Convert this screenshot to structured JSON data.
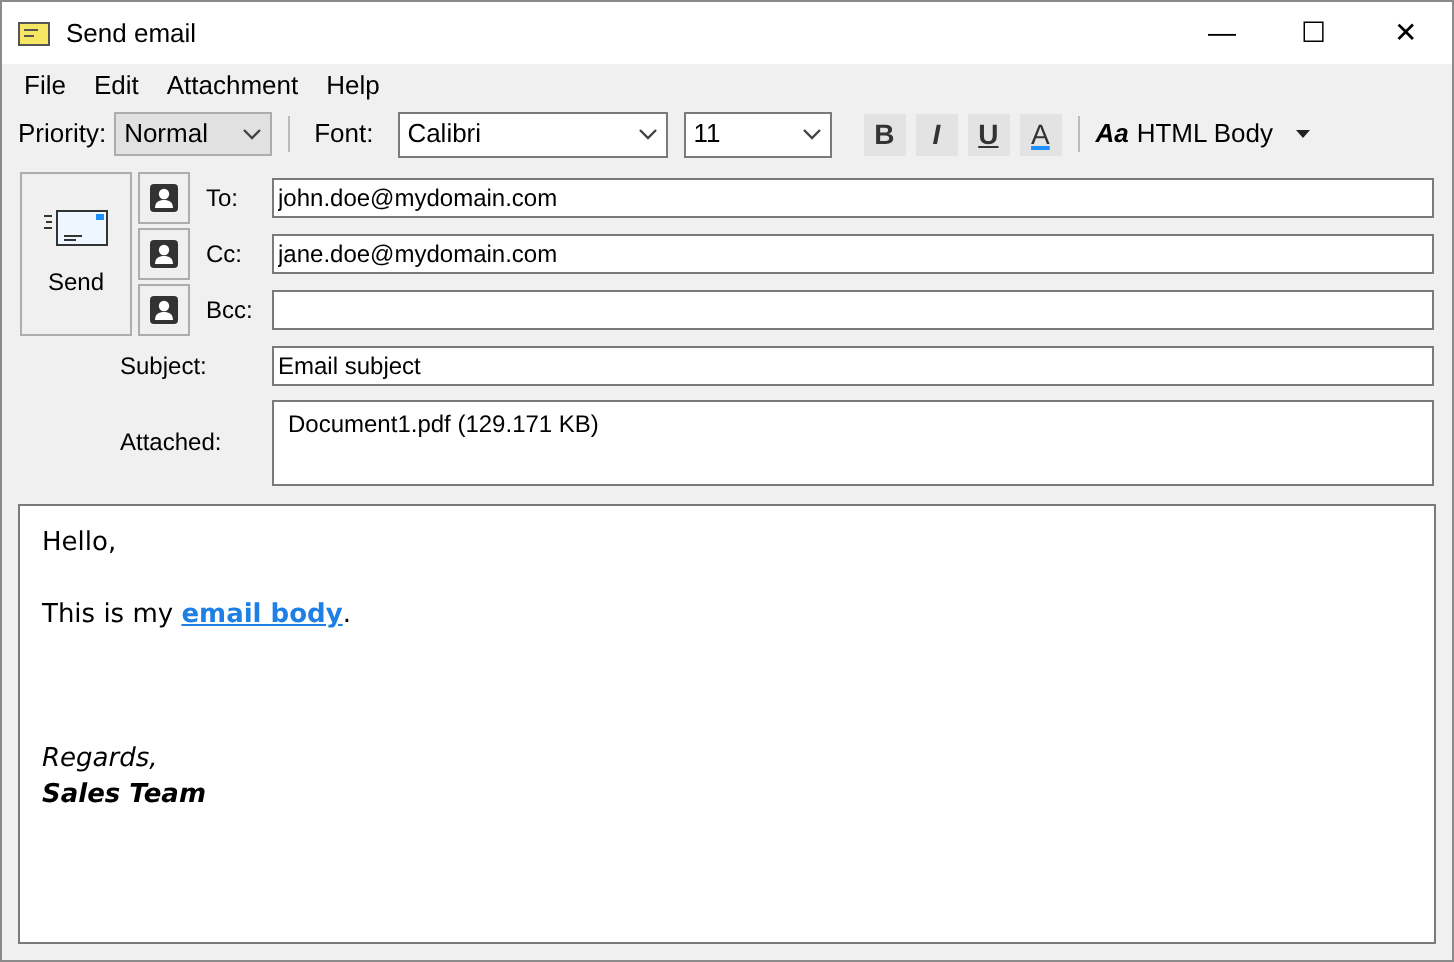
{
  "window": {
    "title": "Send email",
    "controls": [
      "—",
      "☐",
      "✕"
    ]
  },
  "menu": [
    "File",
    "Edit",
    "Attachment",
    "Help"
  ],
  "toolbar": {
    "priority_label": "Priority:",
    "priority": "Normal",
    "font_label": "Font:",
    "font": "Calibri",
    "size": "11",
    "format_buttons": [
      {
        "label": "B",
        "kind": "bold"
      },
      {
        "label": "I",
        "kind": "italic"
      },
      {
        "label": "U",
        "kind": "underline"
      },
      {
        "label": "A",
        "kind": "color"
      }
    ],
    "body_format": {
      "icon": "Aa",
      "label": "HTML Body"
    }
  },
  "send_button": "Send",
  "recipients": [
    {
      "label": "To:",
      "value": "john.doe@mydomain.com"
    },
    {
      "label": "Cc:",
      "value": "jane.doe@mydomain.com"
    },
    {
      "label": "Bcc:"
    }
  ],
  "subject": {
    "label": "Subject:",
    "value": "Email subject"
  },
  "attached": {
    "label": "Attached:",
    "files": [
      "Document1.pdf (129.171 KB)"
    ]
  },
  "body": [
    {
      "kind": "plain",
      "text": "Hello,"
    },
    {
      "kind": "blank"
    },
    {
      "kind": "link",
      "before": "This is my ",
      "link": "email body",
      "after": "."
    },
    {
      "kind": "blank"
    },
    {
      "kind": "blank"
    },
    {
      "kind": "blank"
    },
    {
      "kind": "italic",
      "text": "Regards,"
    },
    {
      "kind": "bold-italic",
      "text": "Sales Team"
    }
  ]
}
